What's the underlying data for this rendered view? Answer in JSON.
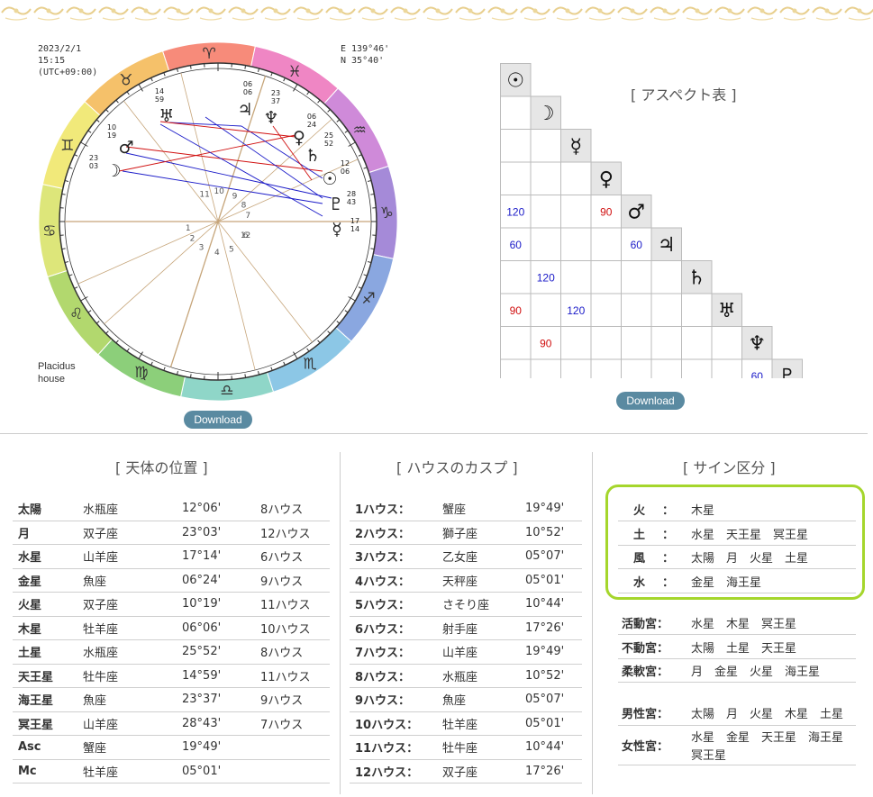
{
  "chart": {
    "date": "2023/2/1",
    "time": "15:15",
    "tz": "(UTC+09:00)",
    "lon": "E 139°46'",
    "lat": "N 35°40'",
    "house_system_line1": "Placidus",
    "house_system_line2": "house",
    "download_label": "Download",
    "sign_glyphs": [
      "♈",
      "♉",
      "♊",
      "♋",
      "♌",
      "♍",
      "♎",
      "♏",
      "♐",
      "♑",
      "♒",
      "♓"
    ],
    "house_numbers": [
      "1",
      "2",
      "3",
      "4",
      "5",
      "6",
      "7",
      "8",
      "9",
      "10",
      "11",
      "12"
    ],
    "planets": [
      {
        "glyph": "☉",
        "deg": "12",
        "min": "06"
      },
      {
        "glyph": "☽",
        "deg": "23",
        "min": "03"
      },
      {
        "glyph": "☿",
        "deg": "17",
        "min": "14"
      },
      {
        "glyph": "♀",
        "deg": "06",
        "min": "24"
      },
      {
        "glyph": "♂",
        "deg": "10",
        "min": "19"
      },
      {
        "glyph": "♃",
        "deg": "06",
        "min": "06"
      },
      {
        "glyph": "♄",
        "deg": "25",
        "min": "52"
      },
      {
        "glyph": "♅",
        "deg": "14",
        "min": "59"
      },
      {
        "glyph": "♆",
        "deg": "23",
        "min": "37"
      },
      {
        "glyph": "♇",
        "deg": "28",
        "min": "43"
      }
    ]
  },
  "aspect": {
    "title": "[ アスペクト表 ]",
    "download_label": "Download",
    "glyphs": [
      "☉",
      "☽",
      "☿",
      "♀",
      "♂",
      "♃",
      "♄",
      "♅",
      "♆",
      "♇"
    ],
    "cells": [
      {
        "row": 4,
        "col": 0,
        "text": "120",
        "kind": "trine"
      },
      {
        "row": 4,
        "col": 3,
        "text": "90",
        "kind": "square"
      },
      {
        "row": 5,
        "col": 0,
        "text": "60",
        "kind": "sextile"
      },
      {
        "row": 5,
        "col": 4,
        "text": "60",
        "kind": "sextile"
      },
      {
        "row": 6,
        "col": 1,
        "text": "120",
        "kind": "trine"
      },
      {
        "row": 7,
        "col": 0,
        "text": "90",
        "kind": "square"
      },
      {
        "row": 7,
        "col": 2,
        "text": "120",
        "kind": "trine"
      },
      {
        "row": 8,
        "col": 1,
        "text": "90",
        "kind": "square"
      },
      {
        "row": 9,
        "col": 8,
        "text": "60",
        "kind": "sextile"
      }
    ],
    "colors": {
      "trine": "#1a1ac8",
      "sextile": "#1a1ac8",
      "square": "#d01010"
    }
  },
  "positions": {
    "title": "[ 天体の位置 ]",
    "rows": [
      {
        "body": "太陽",
        "sign": "水瓶座",
        "degree": "12°06'",
        "house": "8ハウス"
      },
      {
        "body": "月",
        "sign": "双子座",
        "degree": "23°03'",
        "house": "12ハウス"
      },
      {
        "body": "水星",
        "sign": "山羊座",
        "degree": "17°14'",
        "house": "6ハウス"
      },
      {
        "body": "金星",
        "sign": "魚座",
        "degree": "06°24'",
        "house": "9ハウス"
      },
      {
        "body": "火星",
        "sign": "双子座",
        "degree": "10°19'",
        "house": "11ハウス"
      },
      {
        "body": "木星",
        "sign": "牡羊座",
        "degree": "06°06'",
        "house": "10ハウス"
      },
      {
        "body": "土星",
        "sign": "水瓶座",
        "degree": "25°52'",
        "house": "8ハウス"
      },
      {
        "body": "天王星",
        "sign": "牡牛座",
        "degree": "14°59'",
        "house": "11ハウス"
      },
      {
        "body": "海王星",
        "sign": "魚座",
        "degree": "23°37'",
        "house": "9ハウス"
      },
      {
        "body": "冥王星",
        "sign": "山羊座",
        "degree": "28°43'",
        "house": "7ハウス"
      },
      {
        "body": "Asc",
        "sign": "蟹座",
        "degree": "19°49'",
        "house": ""
      },
      {
        "body": "Mc",
        "sign": "牡羊座",
        "degree": "05°01'",
        "house": ""
      }
    ]
  },
  "houses": {
    "title": "[ ハウスのカスプ ]",
    "rows": [
      {
        "house": "1ハウス：",
        "sign": "蟹座",
        "degree": "19°49'"
      },
      {
        "house": "2ハウス：",
        "sign": "獅子座",
        "degree": "10°52'"
      },
      {
        "house": "3ハウス：",
        "sign": "乙女座",
        "degree": "05°07'"
      },
      {
        "house": "4ハウス：",
        "sign": "天秤座",
        "degree": "05°01'"
      },
      {
        "house": "5ハウス：",
        "sign": "さそり座",
        "degree": "10°44'"
      },
      {
        "house": "6ハウス：",
        "sign": "射手座",
        "degree": "17°26'"
      },
      {
        "house": "7ハウス：",
        "sign": "山羊座",
        "degree": "19°49'"
      },
      {
        "house": "8ハウス：",
        "sign": "水瓶座",
        "degree": "10°52'"
      },
      {
        "house": "9ハウス：",
        "sign": "魚座",
        "degree": "05°07'"
      },
      {
        "house": "10ハウス：",
        "sign": "牡羊座",
        "degree": "05°01'"
      },
      {
        "house": "11ハウス：",
        "sign": "牡牛座",
        "degree": "10°44'"
      },
      {
        "house": "12ハウス：",
        "sign": "双子座",
        "degree": "17°26'"
      }
    ]
  },
  "signs": {
    "title": "[ サイン区分 ]",
    "elements": [
      {
        "key": "火",
        "sep": "：",
        "planets": "木星"
      },
      {
        "key": "土",
        "sep": "：",
        "planets": "水星　天王星　冥王星"
      },
      {
        "key": "風",
        "sep": "：",
        "planets": "太陽　月　火星　土星"
      },
      {
        "key": "水",
        "sep": "：",
        "planets": "金星　海王星"
      }
    ],
    "modes": [
      {
        "key": "活動宮：",
        "planets": "水星　木星　冥王星"
      },
      {
        "key": "不動宮：",
        "planets": "太陽　土星　天王星"
      },
      {
        "key": "柔軟宮：",
        "planets": "月　金星　火星　海王星"
      }
    ],
    "genders": [
      {
        "key": "男性宮：",
        "planets": "太陽　月　火星　木星　土星"
      },
      {
        "key": "女性宮：",
        "planets_line1": "水星　金星　天王星　海王星",
        "planets_line2": "冥王星"
      }
    ],
    "highlight_color": "#a5d62c"
  }
}
